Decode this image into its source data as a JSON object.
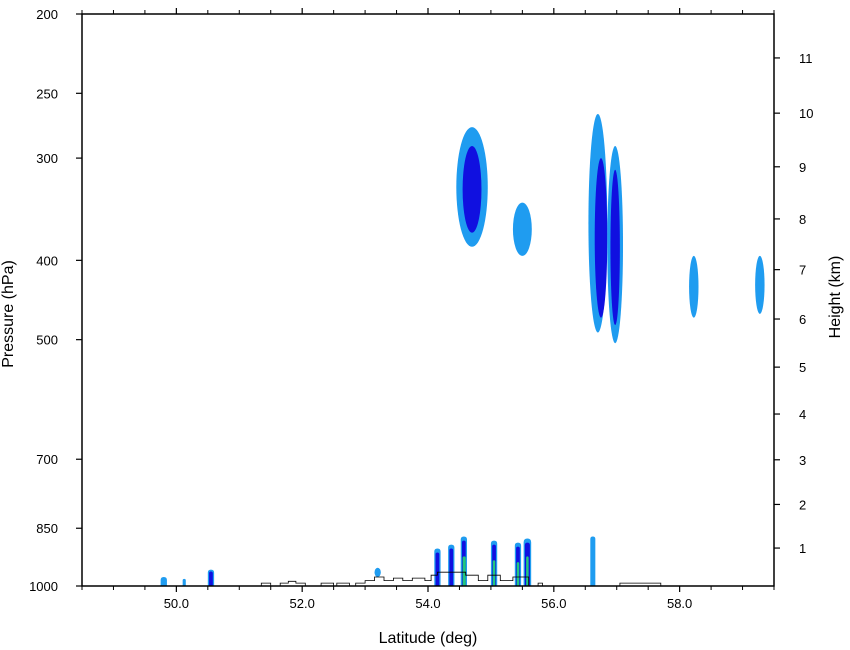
{
  "chart_data": {
    "type": "heatmap",
    "xlabel": "Latitude (deg)",
    "ylabel": "Pressure (hPa)",
    "y2label": "Height (km)",
    "xlim": [
      48.5,
      59.5
    ],
    "x_ticks": [
      50.0,
      52.0,
      54.0,
      56.0,
      58.0
    ],
    "x_tick_labels": [
      "50.0",
      "52.0",
      "54.0",
      "56.0",
      "58.0"
    ],
    "ylim_hpa": [
      1000,
      200
    ],
    "y_scale": "log",
    "y_ticks": [
      200,
      250,
      300,
      400,
      500,
      700,
      850,
      1000
    ],
    "y_tick_labels": [
      "200",
      "250",
      "300",
      "400",
      "500",
      "700",
      "850",
      "1000"
    ],
    "y2_ticks": [
      1,
      2,
      3,
      4,
      5,
      6,
      7,
      8,
      9,
      10,
      11
    ],
    "y2_tick_labels": [
      "1",
      "2",
      "3",
      "4",
      "5",
      "6",
      "7",
      "8",
      "9",
      "10",
      "11"
    ],
    "levels": [
      {
        "level": 1,
        "color": "#1f9cf0"
      },
      {
        "level": 2,
        "color": "#1010e0"
      },
      {
        "level": 3,
        "color": "#23c77b"
      }
    ],
    "features": [
      {
        "lat": [
          54.45,
          54.95
        ],
        "p": [
          275,
          385
        ],
        "level": 1
      },
      {
        "lat": [
          54.55,
          54.85
        ],
        "p": [
          290,
          370
        ],
        "level": 2
      },
      {
        "lat": [
          55.35,
          55.65
        ],
        "p": [
          340,
          395
        ],
        "level": 1
      },
      {
        "lat": [
          56.55,
          56.85
        ],
        "p": [
          265,
          490
        ],
        "level": 1
      },
      {
        "lat": [
          56.65,
          56.85
        ],
        "p": [
          300,
          470
        ],
        "level": 2
      },
      {
        "lat": [
          56.85,
          57.1
        ],
        "p": [
          290,
          505
        ],
        "level": 1
      },
      {
        "lat": [
          56.9,
          57.05
        ],
        "p": [
          310,
          480
        ],
        "level": 2
      },
      {
        "lat": [
          58.15,
          58.3
        ],
        "p": [
          395,
          470
        ],
        "level": 1
      },
      {
        "lat": [
          59.2,
          59.35
        ],
        "p": [
          395,
          465
        ],
        "level": 1
      },
      {
        "lat": [
          49.75,
          49.85
        ],
        "p": [
          975,
          1000
        ],
        "level": 1
      },
      {
        "lat": [
          50.1,
          50.15
        ],
        "p": [
          980,
          1000
        ],
        "level": 1
      },
      {
        "lat": [
          50.5,
          50.6
        ],
        "p": [
          955,
          1000
        ],
        "level": 1
      },
      {
        "lat": [
          50.52,
          50.58
        ],
        "p": [
          960,
          1000
        ],
        "level": 2
      },
      {
        "lat": [
          53.15,
          53.25
        ],
        "p": [
          950,
          975
        ],
        "level": 1
      },
      {
        "lat": [
          54.1,
          54.2
        ],
        "p": [
          900,
          1000
        ],
        "level": 1
      },
      {
        "lat": [
          54.12,
          54.18
        ],
        "p": [
          910,
          1000
        ],
        "level": 2
      },
      {
        "lat": [
          54.32,
          54.42
        ],
        "p": [
          890,
          1000
        ],
        "level": 1
      },
      {
        "lat": [
          54.34,
          54.4
        ],
        "p": [
          900,
          1000
        ],
        "level": 2
      },
      {
        "lat": [
          54.52,
          54.62
        ],
        "p": [
          870,
          1000
        ],
        "level": 1
      },
      {
        "lat": [
          54.54,
          54.6
        ],
        "p": [
          880,
          1000
        ],
        "level": 2
      },
      {
        "lat": [
          54.55,
          54.6
        ],
        "p": [
          920,
          1000
        ],
        "level": 3
      },
      {
        "lat": [
          55.0,
          55.1
        ],
        "p": [
          880,
          1000
        ],
        "level": 1
      },
      {
        "lat": [
          55.02,
          55.08
        ],
        "p": [
          890,
          1000
        ],
        "level": 2
      },
      {
        "lat": [
          55.03,
          55.07
        ],
        "p": [
          930,
          1000
        ],
        "level": 3
      },
      {
        "lat": [
          55.38,
          55.48
        ],
        "p": [
          885,
          1000
        ],
        "level": 1
      },
      {
        "lat": [
          55.4,
          55.46
        ],
        "p": [
          895,
          1000
        ],
        "level": 2
      },
      {
        "lat": [
          55.41,
          55.45
        ],
        "p": [
          935,
          1000
        ],
        "level": 3
      },
      {
        "lat": [
          55.52,
          55.64
        ],
        "p": [
          875,
          1000
        ],
        "level": 1
      },
      {
        "lat": [
          55.54,
          55.62
        ],
        "p": [
          885,
          1000
        ],
        "level": 2
      },
      {
        "lat": [
          55.56,
          55.6
        ],
        "p": [
          920,
          1000
        ],
        "level": 3
      },
      {
        "lat": [
          56.58,
          56.66
        ],
        "p": [
          870,
          1000
        ],
        "level": 1
      }
    ],
    "terrain": [
      [
        51.35,
        1000
      ],
      [
        51.35,
        992
      ],
      [
        51.5,
        992
      ],
      [
        51.5,
        1000
      ],
      [
        51.65,
        1000
      ],
      [
        51.65,
        992
      ],
      [
        51.78,
        992
      ],
      [
        51.78,
        987
      ],
      [
        51.9,
        987
      ],
      [
        51.9,
        992
      ],
      [
        52.05,
        992
      ],
      [
        52.05,
        1000
      ],
      [
        52.3,
        1000
      ],
      [
        52.3,
        992
      ],
      [
        52.5,
        992
      ],
      [
        52.5,
        1000
      ],
      [
        52.55,
        1000
      ],
      [
        52.55,
        992
      ],
      [
        52.75,
        992
      ],
      [
        52.75,
        1000
      ],
      [
        52.85,
        1000
      ],
      [
        52.85,
        992
      ],
      [
        53.0,
        992
      ],
      [
        53.0,
        985
      ],
      [
        53.15,
        985
      ],
      [
        53.15,
        975
      ],
      [
        53.3,
        975
      ],
      [
        53.3,
        985
      ],
      [
        53.45,
        985
      ],
      [
        53.45,
        978
      ],
      [
        53.6,
        978
      ],
      [
        53.6,
        985
      ],
      [
        53.75,
        985
      ],
      [
        53.75,
        978
      ],
      [
        53.95,
        978
      ],
      [
        53.95,
        985
      ],
      [
        54.05,
        985
      ],
      [
        54.05,
        970
      ],
      [
        54.15,
        970
      ],
      [
        54.15,
        962
      ],
      [
        54.6,
        962
      ],
      [
        54.6,
        970
      ],
      [
        54.8,
        970
      ],
      [
        54.8,
        985
      ],
      [
        54.95,
        985
      ],
      [
        54.95,
        970
      ],
      [
        55.15,
        970
      ],
      [
        55.15,
        985
      ],
      [
        55.35,
        985
      ],
      [
        55.35,
        975
      ],
      [
        55.6,
        975
      ],
      [
        55.6,
        1000
      ],
      [
        55.75,
        1000
      ],
      [
        55.75,
        992
      ],
      [
        55.82,
        992
      ],
      [
        55.82,
        1000
      ],
      [
        57.05,
        1000
      ],
      [
        57.05,
        992
      ],
      [
        57.7,
        992
      ],
      [
        57.7,
        1000
      ]
    ]
  }
}
